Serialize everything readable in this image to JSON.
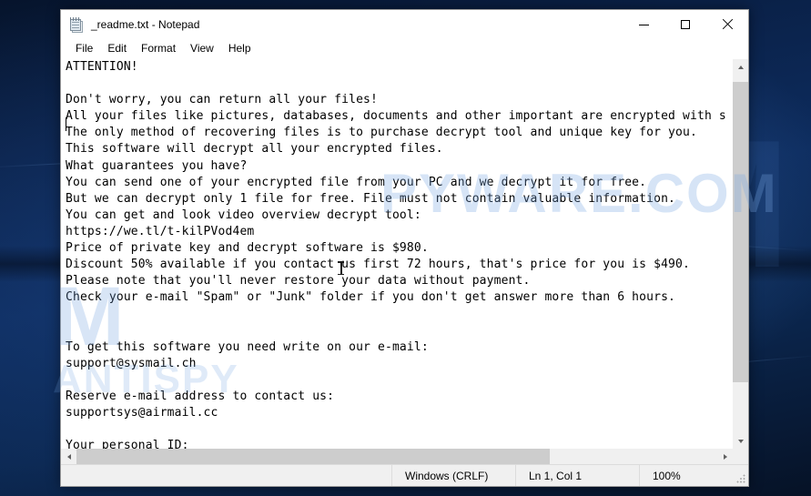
{
  "window": {
    "title": "_readme.txt - Notepad",
    "icon": "notepad-icon",
    "controls": {
      "minimize": "minimize",
      "maximize": "maximize",
      "close": "close"
    }
  },
  "menubar": {
    "items": [
      {
        "label": "File"
      },
      {
        "label": "Edit"
      },
      {
        "label": "Format"
      },
      {
        "label": "View"
      },
      {
        "label": "Help"
      }
    ]
  },
  "document": {
    "filename": "_readme.txt",
    "content": "ATTENTION!\n\nDon't worry, you can return all your files!\nAll your files like pictures, databases, documents and other important are encrypted with s\nThe only method of recovering files is to purchase decrypt tool and unique key for you.\nThis software will decrypt all your encrypted files.\nWhat guarantees you have?\nYou can send one of your encrypted file from your PC and we decrypt it for free.\nBut we can decrypt only 1 file for free. File must not contain valuable information.\nYou can get and look video overview decrypt tool:\nhttps://we.tl/t-kilPVod4em\nPrice of private key and decrypt software is $980.\nDiscount 50% available if you contact us first 72 hours, that's price for you is $490.\nPlease note that you'll never restore your data without payment.\nCheck your e-mail \"Spam\" or \"Junk\" folder if you don't get answer more than 6 hours.\n\n\nTo get this software you need write on our e-mail:\nsupport@sysmail.ch\n\nReserve e-mail address to contact us:\nsupportsys@airmail.cc\n\nYour personal ID:",
    "lines": [
      "ATTENTION!",
      "",
      "Don't worry, you can return all your files!",
      "All your files like pictures, databases, documents and other important are encrypted with s",
      "The only method of recovering files is to purchase decrypt tool and unique key for you.",
      "This software will decrypt all your encrypted files.",
      "What guarantees you have?",
      "You can send one of your encrypted file from your PC and we decrypt it for free.",
      "But we can decrypt only 1 file for free. File must not contain valuable information.",
      "You can get and look video overview decrypt tool:",
      "https://we.tl/t-kilPVod4em",
      "Price of private key and decrypt software is $980.",
      "Discount 50% available if you contact us first 72 hours, that's price for you is $490.",
      "Please note that you'll never restore your data without payment.",
      "Check your e-mail \"Spam\" or \"Junk\" folder if you don't get answer more than 6 hours.",
      "",
      "",
      "To get this software you need write on our e-mail:",
      "support@sysmail.ch",
      "",
      "Reserve e-mail address to contact us:",
      "supportsys@airmail.cc",
      "",
      "Your personal ID:"
    ],
    "download_url": "https://we.tl/t-kilPVod4em",
    "primary_email": "support@sysmail.ch",
    "reserve_email": "supportsys@airmail.cc",
    "full_price": "$980",
    "discount_price": "$490",
    "discount_percent": "50%",
    "discount_window_hours": "72",
    "answer_wait_hours": "6"
  },
  "statusbar": {
    "line_ending": "Windows (CRLF)",
    "cursor_position": "Ln 1, Col 1",
    "zoom": "100%"
  },
  "scrollbars": {
    "vertical_up": "scroll-up",
    "vertical_down": "scroll-down",
    "horizontal_left": "scroll-left",
    "horizontal_right": "scroll-right"
  },
  "watermark": {
    "line1": "PYWARE.COM",
    "line2": "M",
    "line3": "ANTISPY"
  },
  "colors": {
    "window_bg": "#ffffff",
    "chrome_bg": "#f0f0f0",
    "scroll_thumb": "#cdcdcd",
    "text": "#000000",
    "desktop": "#0d2c5e"
  }
}
